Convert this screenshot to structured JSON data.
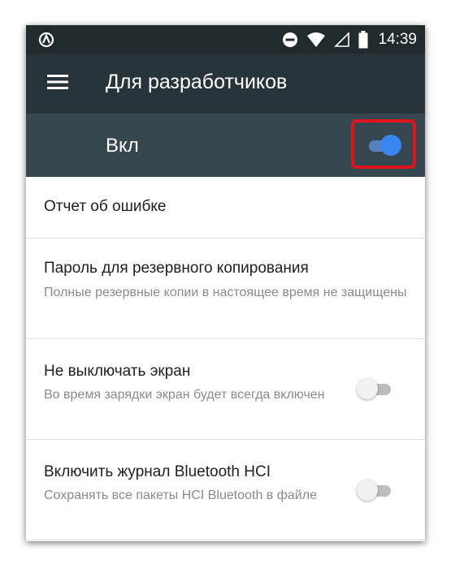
{
  "status_bar": {
    "time": "14:39",
    "icons": [
      "android-auto-icon",
      "do-not-disturb-icon",
      "wifi-icon",
      "cell-signal-icon",
      "battery-icon"
    ]
  },
  "app_bar": {
    "title": "Для разработчиков",
    "menu_icon": "hamburger-menu-icon"
  },
  "master_switch": {
    "label": "Вкл",
    "state": "on",
    "color": "#3a86f1"
  },
  "settings": [
    {
      "title": "Отчет об ошибке"
    },
    {
      "title": "Пароль для резервного копирования",
      "summary": "Полные резервные копии в настоящее время не защищены"
    },
    {
      "title": "Не выключать экран",
      "summary": "Во время зарядки экран будет всегда включен",
      "toggle": "off"
    },
    {
      "title": "Включить журнал Bluetooth HCI",
      "summary": "Сохранять все пакеты HCI Bluetooth в файле",
      "toggle": "off"
    }
  ],
  "colors": {
    "status_bar": "#212b2e",
    "app_bar": "#27353a",
    "master_bar": "#37474f",
    "highlight": "#e0141c"
  }
}
